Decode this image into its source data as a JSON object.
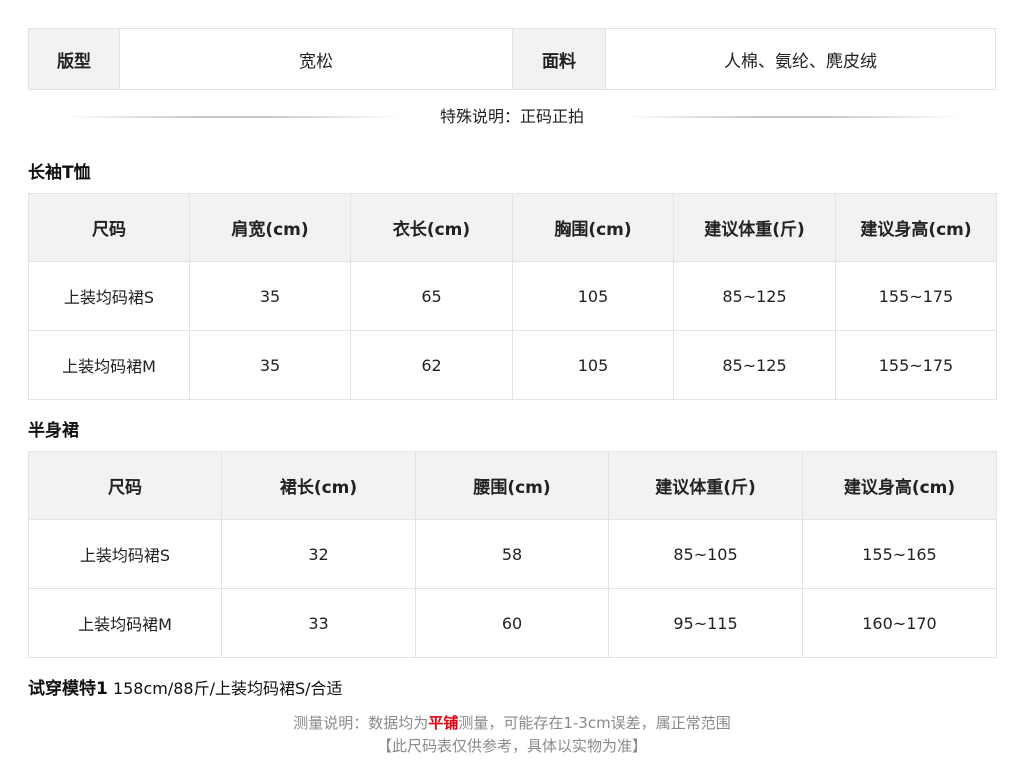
{
  "info": {
    "label_fit": "版型",
    "fit": "宽松",
    "label_fabric": "面料",
    "fabric": "人棉、氨纶、麂皮绒"
  },
  "special_note": "特殊说明：正码正拍",
  "tshirt": {
    "title": "长袖T恤",
    "headers": [
      "尺码",
      "肩宽(cm)",
      "衣长(cm)",
      "胸围(cm)",
      "建议体重(斤)",
      "建议身高(cm)"
    ],
    "rows": [
      [
        "上装均码裙S",
        "35",
        "65",
        "105",
        "85~125",
        "155~175"
      ],
      [
        "上装均码裙M",
        "35",
        "62",
        "105",
        "85~125",
        "155~175"
      ]
    ]
  },
  "skirt": {
    "title": "半身裙",
    "headers": [
      "尺码",
      "裙长(cm)",
      "腰围(cm)",
      "建议体重(斤)",
      "建议身高(cm)"
    ],
    "rows": [
      [
        "上装均码裙S",
        "32",
        "58",
        "85~105",
        "155~165"
      ],
      [
        "上装均码裙M",
        "33",
        "60",
        "95~115",
        "160~170"
      ]
    ]
  },
  "model": {
    "label": "试穿模特1",
    "detail": "158cm/88斤/上装均码裙S/合适"
  },
  "footer": {
    "line1_pre": "测量说明：数据均为",
    "line1_highlight": "平铺",
    "line1_post": "测量，可能存在1-3cm误差，属正常范围",
    "line2": "【此尺码表仅供参考，具体以实物为准】"
  },
  "colors": {
    "header_bg": "#f2f2f2",
    "border": "#e3e3e3",
    "highlight": "#e60012",
    "note_text": "#8a8a8a"
  }
}
